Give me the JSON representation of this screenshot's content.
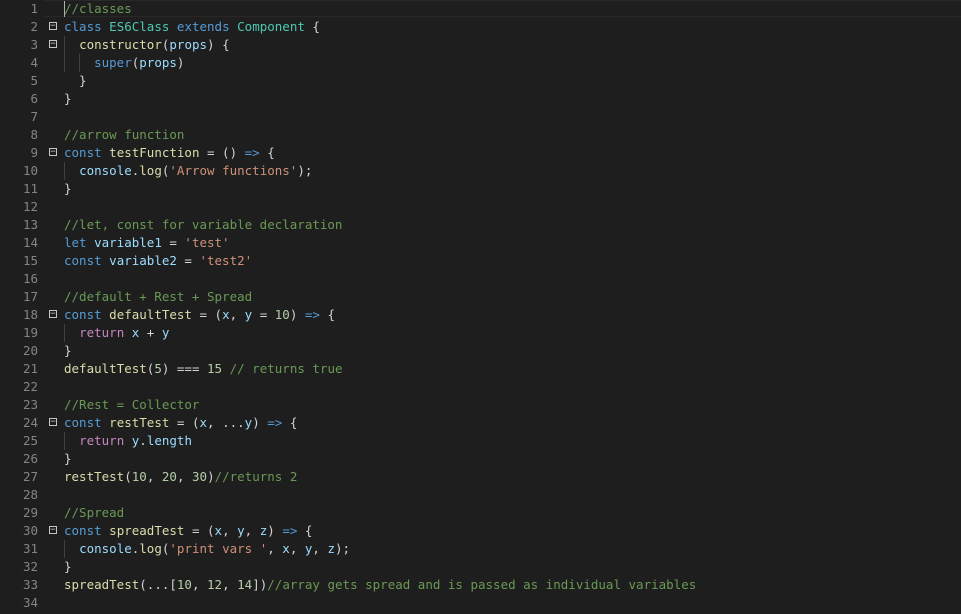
{
  "editor": {
    "colors": {
      "background": "#1e1e1e",
      "keyword": "#569cd6",
      "control_keyword": "#c586c0",
      "class": "#4ec9b0",
      "function": "#dcdcaa",
      "variable": "#9cdcfe",
      "string": "#ce9178",
      "number": "#b5cea8",
      "comment": "#6a9955",
      "line_number": "#858585"
    },
    "lines": [
      {
        "n": "1",
        "fold": false,
        "tokens": [
          {
            "t": "//classes",
            "c": "cm"
          }
        ]
      },
      {
        "n": "2",
        "fold": true,
        "tokens": [
          {
            "t": "class",
            "c": "kw"
          },
          {
            "t": " ",
            "c": "op"
          },
          {
            "t": "ES6Class",
            "c": "cls"
          },
          {
            "t": " ",
            "c": "op"
          },
          {
            "t": "extends",
            "c": "kw"
          },
          {
            "t": " ",
            "c": "op"
          },
          {
            "t": "Component",
            "c": "cls"
          },
          {
            "t": " {",
            "c": "op"
          }
        ]
      },
      {
        "n": "3",
        "fold": true,
        "tokens": [
          {
            "t": "  ",
            "c": "op"
          },
          {
            "t": "constructor",
            "c": "fn"
          },
          {
            "t": "(",
            "c": "op"
          },
          {
            "t": "props",
            "c": "var"
          },
          {
            "t": ") {",
            "c": "op"
          }
        ]
      },
      {
        "n": "4",
        "fold": false,
        "tokens": [
          {
            "t": "    ",
            "c": "op"
          },
          {
            "t": "super",
            "c": "kw"
          },
          {
            "t": "(",
            "c": "op"
          },
          {
            "t": "props",
            "c": "var"
          },
          {
            "t": ")",
            "c": "op"
          }
        ]
      },
      {
        "n": "5",
        "fold": false,
        "tokens": [
          {
            "t": "  }",
            "c": "op"
          }
        ]
      },
      {
        "n": "6",
        "fold": false,
        "tokens": [
          {
            "t": "}",
            "c": "op"
          }
        ]
      },
      {
        "n": "7",
        "fold": false,
        "tokens": []
      },
      {
        "n": "8",
        "fold": false,
        "tokens": [
          {
            "t": "//arrow function",
            "c": "cm"
          }
        ]
      },
      {
        "n": "9",
        "fold": true,
        "tokens": [
          {
            "t": "const",
            "c": "kw"
          },
          {
            "t": " ",
            "c": "op"
          },
          {
            "t": "testFunction",
            "c": "fn"
          },
          {
            "t": " = () ",
            "c": "op"
          },
          {
            "t": "=>",
            "c": "kw"
          },
          {
            "t": " {",
            "c": "op"
          }
        ]
      },
      {
        "n": "10",
        "fold": false,
        "tokens": [
          {
            "t": "  ",
            "c": "op"
          },
          {
            "t": "console",
            "c": "var"
          },
          {
            "t": ".",
            "c": "op"
          },
          {
            "t": "log",
            "c": "fn"
          },
          {
            "t": "(",
            "c": "op"
          },
          {
            "t": "'Arrow functions'",
            "c": "str"
          },
          {
            "t": ");",
            "c": "op"
          }
        ]
      },
      {
        "n": "11",
        "fold": false,
        "tokens": [
          {
            "t": "}",
            "c": "op"
          }
        ]
      },
      {
        "n": "12",
        "fold": false,
        "tokens": []
      },
      {
        "n": "13",
        "fold": false,
        "tokens": [
          {
            "t": "//let, const for variable declaration",
            "c": "cm"
          }
        ]
      },
      {
        "n": "14",
        "fold": false,
        "tokens": [
          {
            "t": "let",
            "c": "kw"
          },
          {
            "t": " ",
            "c": "op"
          },
          {
            "t": "variable1",
            "c": "var"
          },
          {
            "t": " = ",
            "c": "op"
          },
          {
            "t": "'test'",
            "c": "str"
          }
        ]
      },
      {
        "n": "15",
        "fold": false,
        "tokens": [
          {
            "t": "const",
            "c": "kw"
          },
          {
            "t": " ",
            "c": "op"
          },
          {
            "t": "variable2",
            "c": "var"
          },
          {
            "t": " = ",
            "c": "op"
          },
          {
            "t": "'test2'",
            "c": "str"
          }
        ]
      },
      {
        "n": "16",
        "fold": false,
        "tokens": []
      },
      {
        "n": "17",
        "fold": false,
        "tokens": [
          {
            "t": "//default + Rest + Spread",
            "c": "cm"
          }
        ]
      },
      {
        "n": "18",
        "fold": true,
        "tokens": [
          {
            "t": "const",
            "c": "kw"
          },
          {
            "t": " ",
            "c": "op"
          },
          {
            "t": "defaultTest",
            "c": "fn"
          },
          {
            "t": " = (",
            "c": "op"
          },
          {
            "t": "x",
            "c": "var"
          },
          {
            "t": ", ",
            "c": "op"
          },
          {
            "t": "y",
            "c": "var"
          },
          {
            "t": " = ",
            "c": "op"
          },
          {
            "t": "10",
            "c": "num"
          },
          {
            "t": ") ",
            "c": "op"
          },
          {
            "t": "=>",
            "c": "kw"
          },
          {
            "t": " {",
            "c": "op"
          }
        ]
      },
      {
        "n": "19",
        "fold": false,
        "tokens": [
          {
            "t": "  ",
            "c": "op"
          },
          {
            "t": "return",
            "c": "kw2"
          },
          {
            "t": " ",
            "c": "op"
          },
          {
            "t": "x",
            "c": "var"
          },
          {
            "t": " + ",
            "c": "op"
          },
          {
            "t": "y",
            "c": "var"
          }
        ]
      },
      {
        "n": "20",
        "fold": false,
        "tokens": [
          {
            "t": "}",
            "c": "op"
          }
        ]
      },
      {
        "n": "21",
        "fold": false,
        "tokens": [
          {
            "t": "defaultTest",
            "c": "fn"
          },
          {
            "t": "(",
            "c": "op"
          },
          {
            "t": "5",
            "c": "num"
          },
          {
            "t": ") === ",
            "c": "op"
          },
          {
            "t": "15",
            "c": "num"
          },
          {
            "t": " ",
            "c": "op"
          },
          {
            "t": "// returns true",
            "c": "cm"
          }
        ]
      },
      {
        "n": "22",
        "fold": false,
        "tokens": []
      },
      {
        "n": "23",
        "fold": false,
        "tokens": [
          {
            "t": "//Rest = Collector",
            "c": "cm"
          }
        ]
      },
      {
        "n": "24",
        "fold": true,
        "tokens": [
          {
            "t": "const",
            "c": "kw"
          },
          {
            "t": " ",
            "c": "op"
          },
          {
            "t": "restTest",
            "c": "fn"
          },
          {
            "t": " = (",
            "c": "op"
          },
          {
            "t": "x",
            "c": "var"
          },
          {
            "t": ", ...",
            "c": "op"
          },
          {
            "t": "y",
            "c": "var"
          },
          {
            "t": ") ",
            "c": "op"
          },
          {
            "t": "=>",
            "c": "kw"
          },
          {
            "t": " {",
            "c": "op"
          }
        ]
      },
      {
        "n": "25",
        "fold": false,
        "tokens": [
          {
            "t": "  ",
            "c": "op"
          },
          {
            "t": "return",
            "c": "kw2"
          },
          {
            "t": " ",
            "c": "op"
          },
          {
            "t": "y",
            "c": "var"
          },
          {
            "t": ".",
            "c": "op"
          },
          {
            "t": "length",
            "c": "var"
          }
        ]
      },
      {
        "n": "26",
        "fold": false,
        "tokens": [
          {
            "t": "}",
            "c": "op"
          }
        ]
      },
      {
        "n": "27",
        "fold": false,
        "tokens": [
          {
            "t": "restTest",
            "c": "fn"
          },
          {
            "t": "(",
            "c": "op"
          },
          {
            "t": "10",
            "c": "num"
          },
          {
            "t": ", ",
            "c": "op"
          },
          {
            "t": "20",
            "c": "num"
          },
          {
            "t": ", ",
            "c": "op"
          },
          {
            "t": "30",
            "c": "num"
          },
          {
            "t": ")",
            "c": "op"
          },
          {
            "t": "//returns 2",
            "c": "cm"
          }
        ]
      },
      {
        "n": "28",
        "fold": false,
        "tokens": []
      },
      {
        "n": "29",
        "fold": false,
        "tokens": [
          {
            "t": "//Spread",
            "c": "cm"
          }
        ]
      },
      {
        "n": "30",
        "fold": true,
        "tokens": [
          {
            "t": "const",
            "c": "kw"
          },
          {
            "t": " ",
            "c": "op"
          },
          {
            "t": "spreadTest",
            "c": "fn"
          },
          {
            "t": " = (",
            "c": "op"
          },
          {
            "t": "x",
            "c": "var"
          },
          {
            "t": ", ",
            "c": "op"
          },
          {
            "t": "y",
            "c": "var"
          },
          {
            "t": ", ",
            "c": "op"
          },
          {
            "t": "z",
            "c": "var"
          },
          {
            "t": ") ",
            "c": "op"
          },
          {
            "t": "=>",
            "c": "kw"
          },
          {
            "t": " {",
            "c": "op"
          }
        ]
      },
      {
        "n": "31",
        "fold": false,
        "tokens": [
          {
            "t": "  ",
            "c": "op"
          },
          {
            "t": "console",
            "c": "var"
          },
          {
            "t": ".",
            "c": "op"
          },
          {
            "t": "log",
            "c": "fn"
          },
          {
            "t": "(",
            "c": "op"
          },
          {
            "t": "'print vars '",
            "c": "str"
          },
          {
            "t": ", ",
            "c": "op"
          },
          {
            "t": "x",
            "c": "var"
          },
          {
            "t": ", ",
            "c": "op"
          },
          {
            "t": "y",
            "c": "var"
          },
          {
            "t": ", ",
            "c": "op"
          },
          {
            "t": "z",
            "c": "var"
          },
          {
            "t": ");",
            "c": "op"
          }
        ]
      },
      {
        "n": "32",
        "fold": false,
        "tokens": [
          {
            "t": "}",
            "c": "op"
          }
        ]
      },
      {
        "n": "33",
        "fold": false,
        "tokens": [
          {
            "t": "spreadTest",
            "c": "fn"
          },
          {
            "t": "(...[",
            "c": "op"
          },
          {
            "t": "10",
            "c": "num"
          },
          {
            "t": ", ",
            "c": "op"
          },
          {
            "t": "12",
            "c": "num"
          },
          {
            "t": ", ",
            "c": "op"
          },
          {
            "t": "14",
            "c": "num"
          },
          {
            "t": "])",
            "c": "op"
          },
          {
            "t": "//array gets spread and is passed as individual variables",
            "c": "cm"
          }
        ]
      },
      {
        "n": "34",
        "fold": false,
        "tokens": []
      }
    ]
  }
}
